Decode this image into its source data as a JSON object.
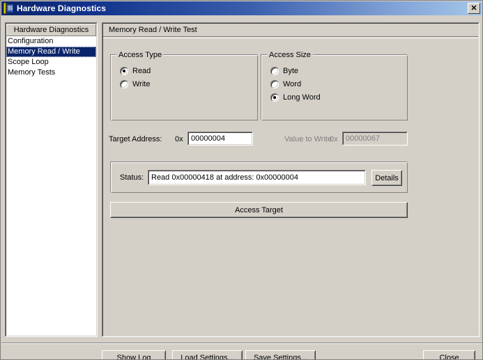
{
  "window": {
    "title": "Hardware Diagnostics",
    "icon": "film-document-icon",
    "close_label": "✕"
  },
  "sidebar": {
    "header": "Hardware Diagnostics",
    "items": [
      {
        "label": "Configuration",
        "selected": false
      },
      {
        "label": "Memory Read / Write",
        "selected": true
      },
      {
        "label": "Scope Loop",
        "selected": false
      },
      {
        "label": "Memory Tests",
        "selected": false
      }
    ]
  },
  "main": {
    "header": "Memory Read / Write Test",
    "access_type": {
      "legend": "Access Type",
      "options": [
        {
          "label": "Read",
          "checked": true
        },
        {
          "label": "Write",
          "checked": false
        }
      ]
    },
    "access_size": {
      "legend": "Access Size",
      "options": [
        {
          "label": "Byte",
          "checked": false
        },
        {
          "label": "Word",
          "checked": false
        },
        {
          "label": "Long Word",
          "checked": true
        }
      ]
    },
    "target_address": {
      "label": "Target Address:",
      "prefix": "0x",
      "value": "00000004",
      "disabled": false
    },
    "value_to_write": {
      "label": "Value to Write:",
      "prefix": "0x",
      "value": "00000067",
      "disabled": true
    },
    "status": {
      "label": "Status:",
      "value": "Read  0x00000418 at address: 0x00000004",
      "details_button": "Details"
    },
    "access_target_button": "Access Target"
  },
  "footer": {
    "show_log": "Show Log",
    "load_settings": "Load Settings...",
    "save_settings": "Save Settings...",
    "close": "Close"
  },
  "colors": {
    "face": "#d4d0c8",
    "title_start": "#0a246a",
    "title_end": "#a6c8ea",
    "selection": "#0a246a",
    "disabled_text": "#808080"
  }
}
